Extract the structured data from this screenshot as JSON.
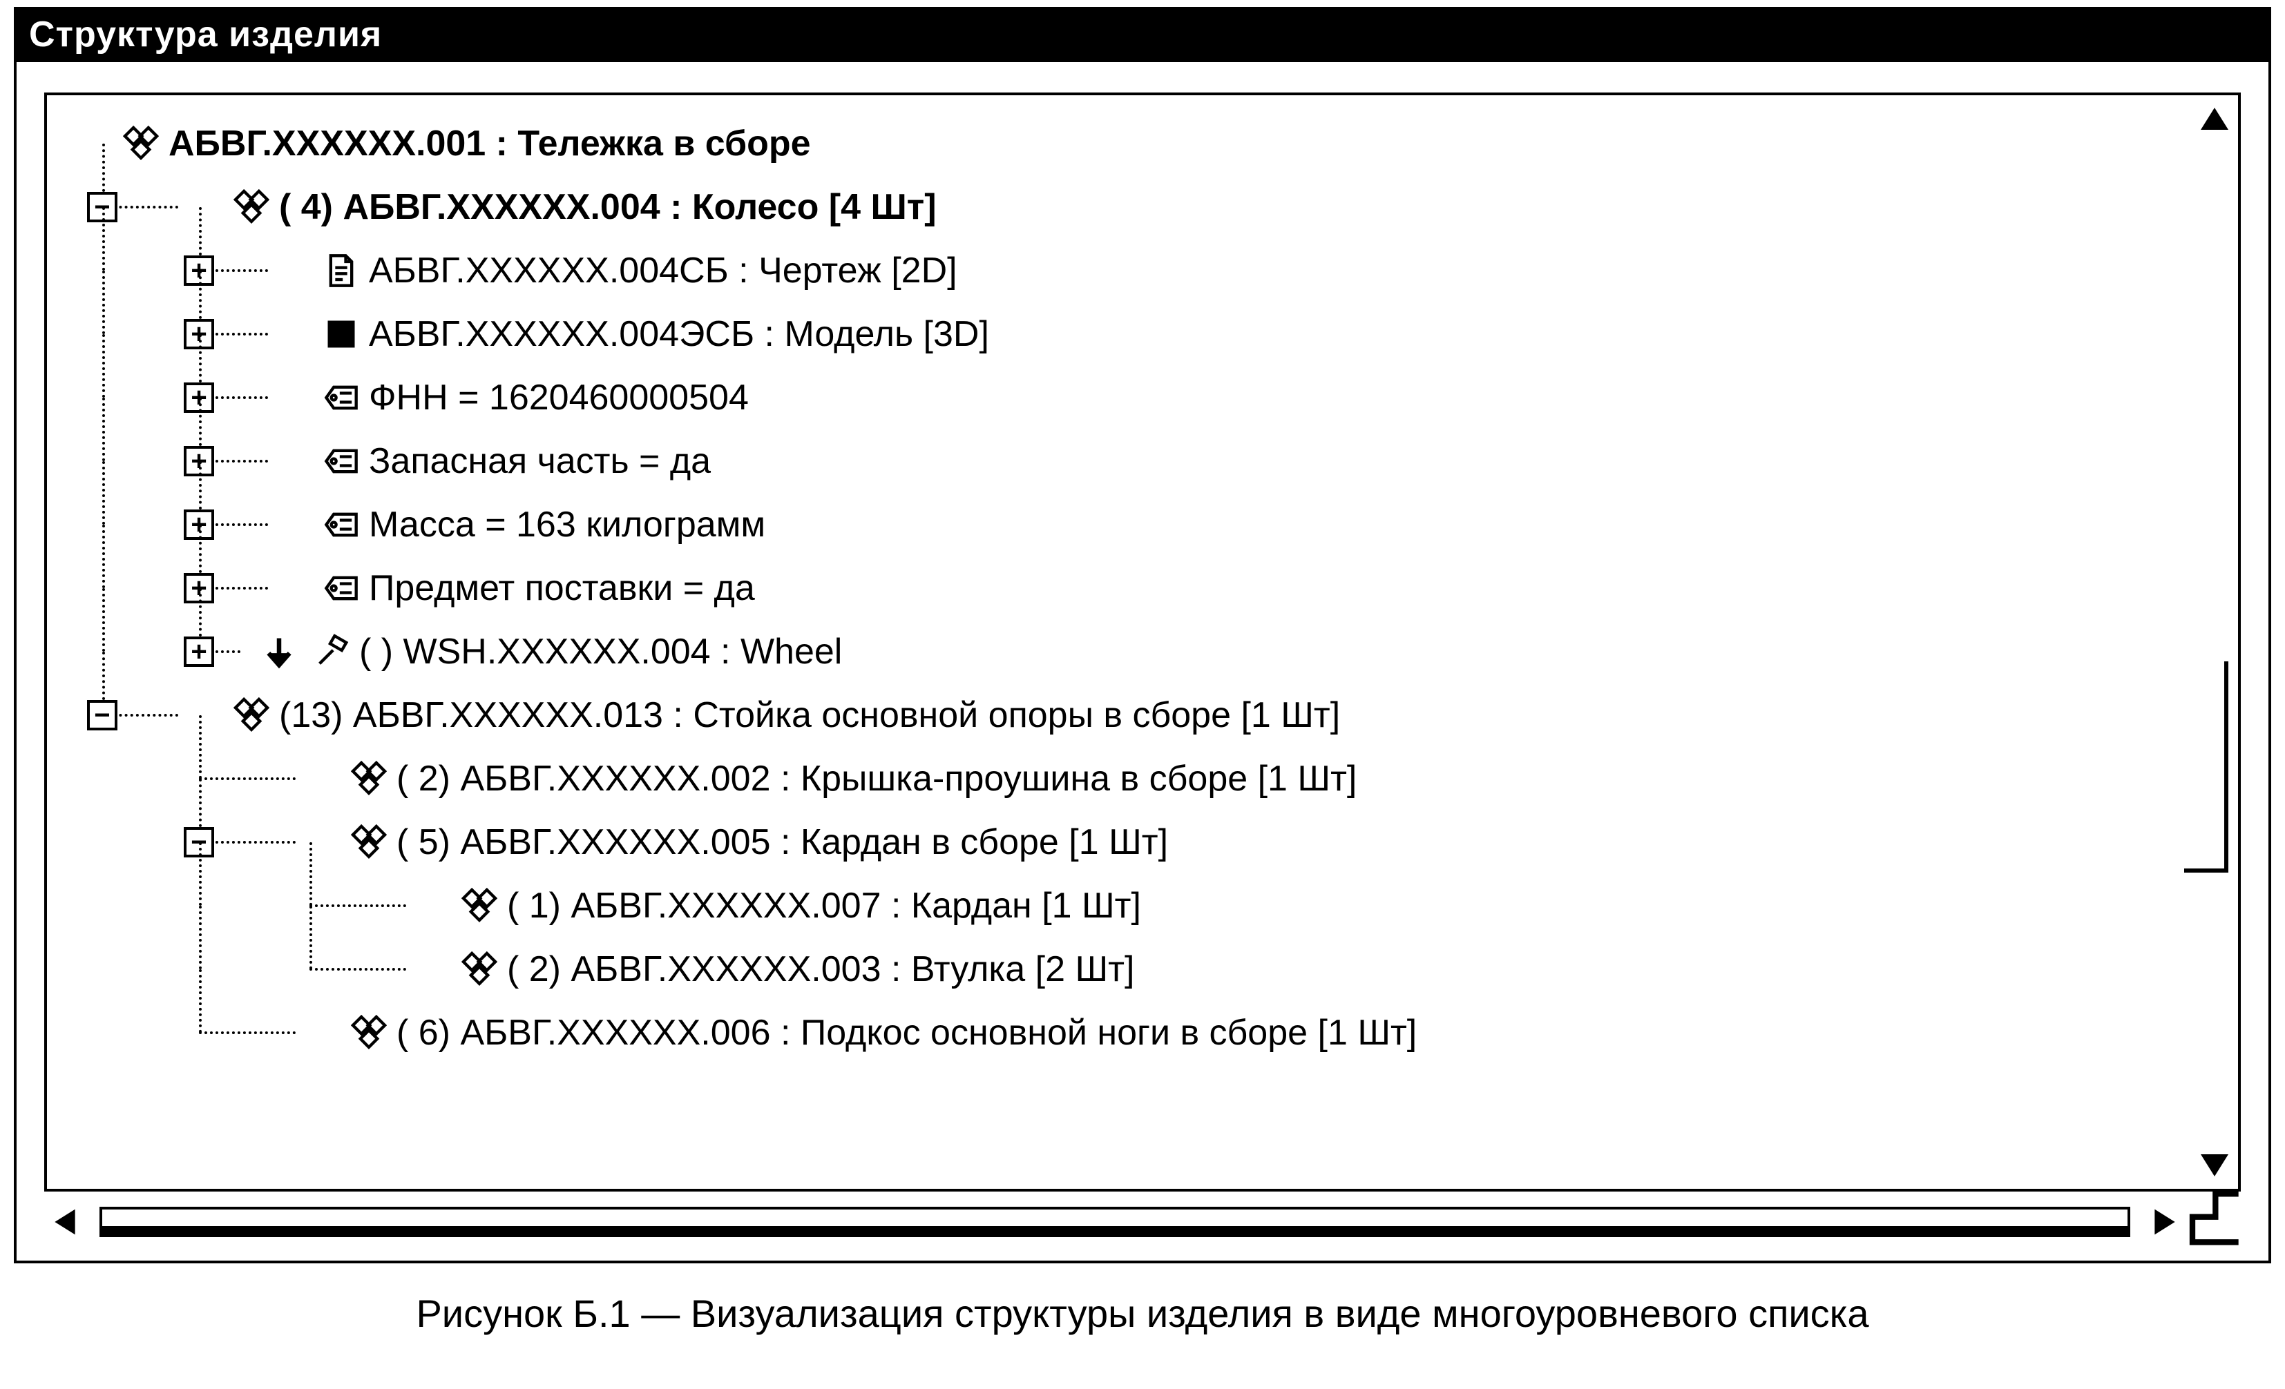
{
  "window": {
    "title": "Структура изделия"
  },
  "caption": "Рисунок Б.1 — Визуализация структуры изделия в виде многоуровневого списка",
  "tree": {
    "root": "АБВГ.ХХХХХХ.001 : Тележка в сборе",
    "n004": "( 4) АБВГ.ХХХХХХ.004 : Колесо [4 Шт]",
    "n004_sb": "АБВГ.ХХХХХХ.004СБ : Чертеж [2D]",
    "n004_esb": "АБВГ.ХХХХХХ.004ЭСБ : Модель [3D]",
    "n004_fnn": "ФНН = 1620460000504",
    "n004_spare": "Запасная часть = да",
    "n004_mass": "Масса = 163 килограмм",
    "n004_supply": "Предмет поставки = да",
    "n004_wsh": "(  ) WSH.XXXXXX.004 : Wheel",
    "n013": "(13) АБВГ.ХХХХХХ.013 : Стойка основной опоры в сборе [1 Шт]",
    "n013_002": "( 2) АБВГ.ХХХХХХ.002 : Крышка-проушина в сборе [1 Шт]",
    "n013_005": "( 5) АБВГ.ХХХХХХ.005 : Кардан в сборе [1 Шт]",
    "n013_005_007": "( 1) АБВГ.ХХХХХХ.007 : Кардан [1 Шт]",
    "n013_005_003": "( 2) АБВГ.ХХХХХХ.003 : Втулка [2 Шт]",
    "n013_006": "( 6) АБВГ.ХХХХХХ.006 : Подкос основной ноги в сборе [1 Шт]"
  },
  "expanders": {
    "plus": "+",
    "minus": "−"
  }
}
